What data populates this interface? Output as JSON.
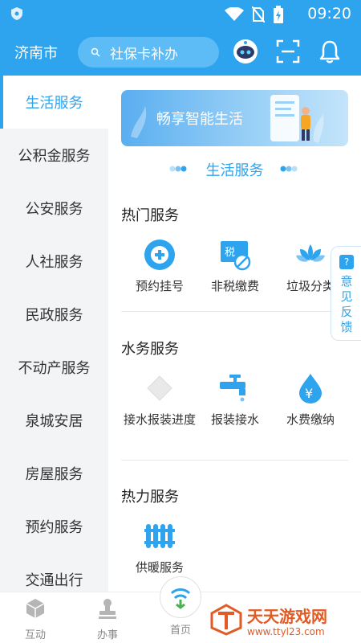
{
  "status_bar": {
    "time": "09:20"
  },
  "header": {
    "city": "济南市",
    "search": {
      "text": "社保卡补办"
    }
  },
  "sidebar": {
    "items": [
      {
        "label": "生活服务",
        "active": true
      },
      {
        "label": "公积金服务",
        "active": false
      },
      {
        "label": "公安服务",
        "active": false
      },
      {
        "label": "人社服务",
        "active": false
      },
      {
        "label": "民政服务",
        "active": false
      },
      {
        "label": "不动产服务",
        "active": false
      },
      {
        "label": "泉城安居",
        "active": false
      },
      {
        "label": "房屋服务",
        "active": false
      },
      {
        "label": "预约服务",
        "active": false
      },
      {
        "label": "交通出行",
        "active": false
      }
    ]
  },
  "main": {
    "banner_text": "畅享智能生活",
    "section_title": "生活服务",
    "groups": [
      {
        "title": "热门服务",
        "items": [
          {
            "label": "预约挂号",
            "icon": "plus-circle-icon"
          },
          {
            "label": "非税缴费",
            "icon": "tax-icon"
          },
          {
            "label": "垃圾分类",
            "icon": "lotus-icon"
          }
        ]
      },
      {
        "title": "水务服务",
        "items": [
          {
            "label": "接水报装进度",
            "icon": "diamond-icon"
          },
          {
            "label": "报装接水",
            "icon": "faucet-icon"
          },
          {
            "label": "水费缴纳",
            "icon": "water-drop-yuan-icon"
          }
        ]
      },
      {
        "title": "热力服务",
        "items": [
          {
            "label": "供暖服务",
            "icon": "radiator-icon"
          }
        ]
      }
    ]
  },
  "feedback": {
    "label": "意见反馈",
    "icon": "question-icon"
  },
  "bottom_nav": {
    "items": [
      {
        "label": "互动",
        "icon": "cube-icon"
      },
      {
        "label": "办事",
        "icon": "stamp-icon"
      },
      {
        "label": "首页",
        "icon": "home-logo-icon"
      }
    ]
  },
  "watermark": {
    "title": "天天游戏网",
    "url": "www.ttyl23.com"
  },
  "colors": {
    "primary": "#2ea3ee",
    "sidebar_bg": "#f3f4f6",
    "watermark": "#e25a24"
  }
}
